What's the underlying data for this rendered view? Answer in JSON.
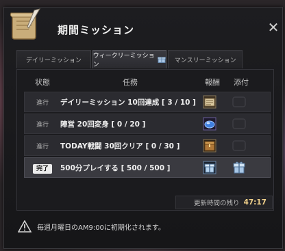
{
  "window": {
    "title": "期間ミッション"
  },
  "tabs": [
    {
      "label": "デイリーミッション",
      "active": false
    },
    {
      "label": "ウィークリーミッション",
      "active": true
    },
    {
      "label": "マンスリーミッション",
      "active": false
    }
  ],
  "columns": {
    "status": "状態",
    "mission": "任務",
    "reward": "報酬",
    "attach": "添付"
  },
  "missions": [
    {
      "status": "進行",
      "text": "デイリーミッション 10回達成 [ 3 / 10 ]",
      "reward_icon": "scroll-book-icon",
      "attach_icon": "empty-slot-icon"
    },
    {
      "status": "進行",
      "text": "陣営 20回変身 [ 0 / 20 ]",
      "reward_icon": "blue-crystal-icon",
      "attach_icon": "empty-slot-icon"
    },
    {
      "status": "進行",
      "text": "TODAY戦闘 30回クリア [ 0 / 30 ]",
      "reward_icon": "treasure-box-icon",
      "attach_icon": "empty-slot-icon"
    },
    {
      "status": "完了",
      "text": "500分プレイする [ 500 / 500 ]",
      "reward_icon": "gift-box-icon",
      "attach_icon": "gift-icon"
    }
  ],
  "timer": {
    "label": "更新時間の残り",
    "value": "47:17"
  },
  "notice": {
    "text": "毎週月曜日のAM9:00に初期化されます。"
  },
  "colors": {
    "accent": "#f0d08a",
    "panel": "#1b1b1e",
    "completed_row": "#3a3a40"
  }
}
